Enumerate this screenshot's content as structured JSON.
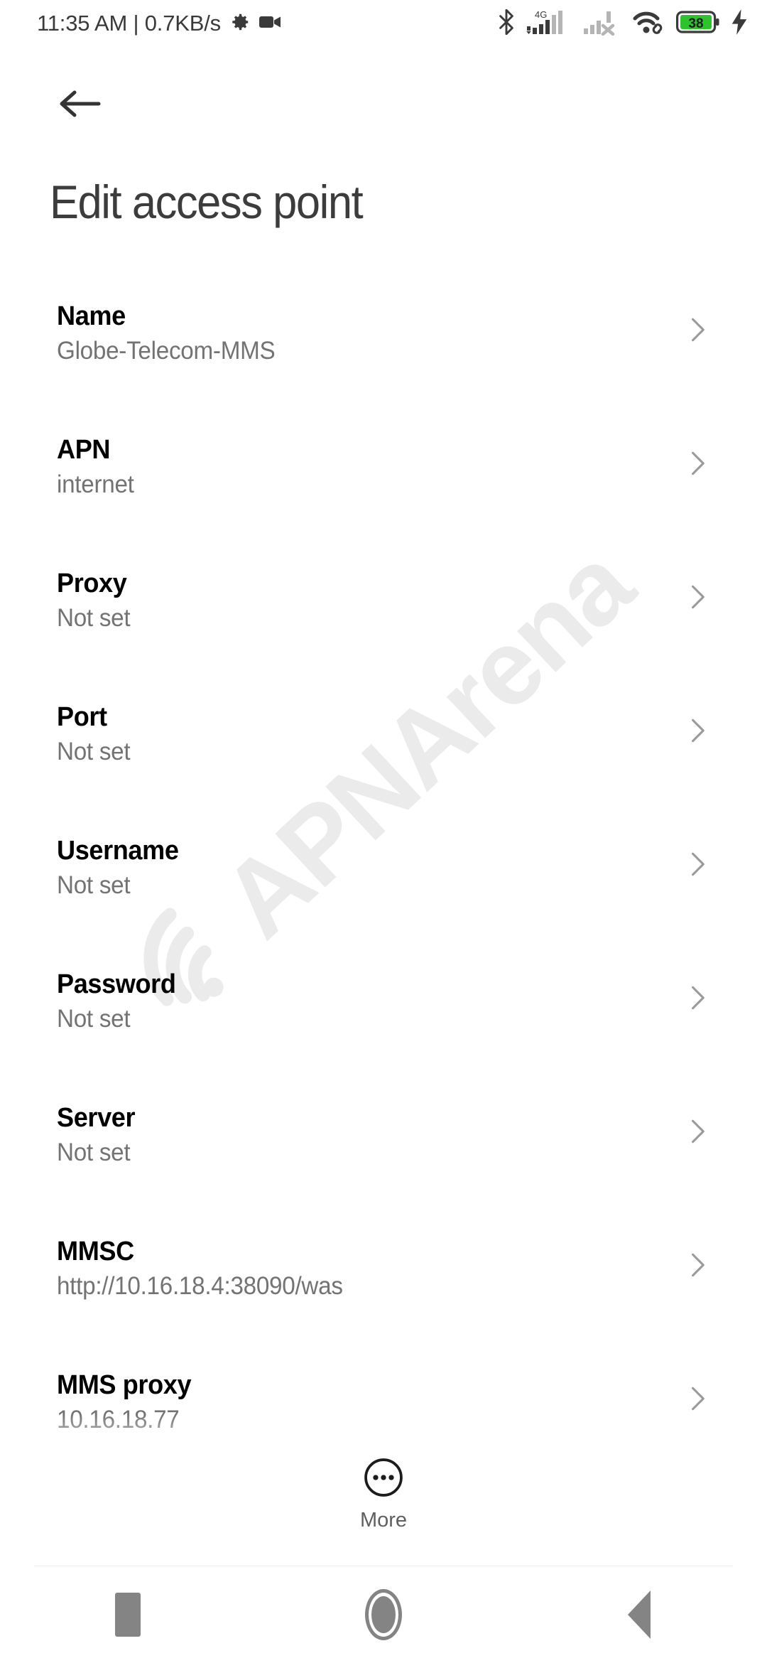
{
  "status_bar": {
    "clock": "11:35 AM | 0.7KB/s",
    "icons_left": [
      "gear-icon",
      "camcorder-icon"
    ],
    "icons_right": [
      "bluetooth-icon",
      "signal-4g-icon",
      "signal-sim2-off-icon",
      "wifi-link-icon",
      "battery-icon",
      "charging-bolt-icon"
    ],
    "network_type": "4G",
    "battery_percent": "38",
    "battery_color": "#2fc22f"
  },
  "app_bar": {
    "back_icon": "arrow-left-icon",
    "title": "Edit access point"
  },
  "watermark": {
    "text": "APNArena",
    "color": "#ebebeb",
    "logo": "wifi-arc-icon"
  },
  "settings": {
    "chevron_icon": "chevron-right-icon",
    "rows": [
      {
        "label": "Name",
        "value": "Globe-Telecom-MMS"
      },
      {
        "label": "APN",
        "value": "internet"
      },
      {
        "label": "Proxy",
        "value": "Not set"
      },
      {
        "label": "Port",
        "value": "Not set"
      },
      {
        "label": "Username",
        "value": "Not set"
      },
      {
        "label": "Password",
        "value": "Not set"
      },
      {
        "label": "Server",
        "value": "Not set"
      },
      {
        "label": "MMSC",
        "value": "http://10.16.18.4:38090/was"
      },
      {
        "label": "MMS proxy",
        "value": "10.16.18.77"
      }
    ]
  },
  "more_button": {
    "label": "More",
    "icon": "more-circle-icon"
  },
  "nav_bar": {
    "items": [
      {
        "name": "recents",
        "icon": "square-icon"
      },
      {
        "name": "home",
        "icon": "circle-icon"
      },
      {
        "name": "back",
        "icon": "triangle-left-icon"
      }
    ],
    "color": "#848484"
  }
}
